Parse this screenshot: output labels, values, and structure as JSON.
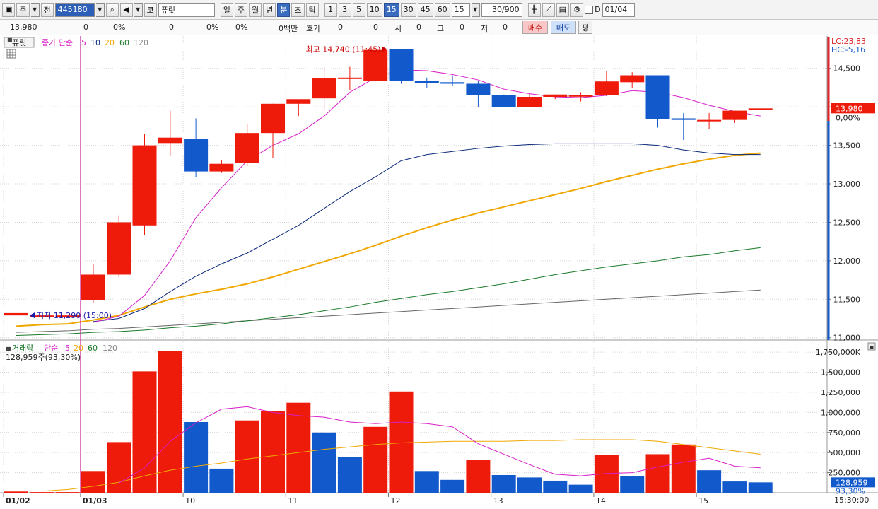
{
  "toolbar": {
    "market": "주",
    "whole": "전",
    "code": "445180",
    "market_type": "코",
    "stock_name": "퓨릿",
    "periods": [
      "일",
      "주",
      "월",
      "년"
    ],
    "units": [
      "분",
      "초",
      "틱"
    ],
    "active_unit": "분",
    "intervals": [
      "1",
      "3",
      "5",
      "10",
      "15",
      "30",
      "45",
      "60"
    ],
    "active_interval": "15",
    "interval_value": "15",
    "count": "30",
    "count_max": "/900",
    "d_label": "D",
    "date": "01/04"
  },
  "quote": {
    "price": "13,980",
    "change": "0",
    "change_pct": "0%",
    "volume": "0",
    "vol_pct": "0%",
    "vol_pct2": "0%",
    "amount": "0백만",
    "hoga_label": "호가",
    "hoga_val1": "0",
    "hoga_val2": "0",
    "open_label": "시",
    "open_val": "0",
    "high_label": "고",
    "high_val": "0",
    "low_label": "저",
    "low_val": "0",
    "buy_label": "매수",
    "sell_label": "매도",
    "flat_label": "평"
  },
  "price_panel": {
    "title": "퓨릿",
    "ma_label": "종가 단순",
    "ma_periods": [
      "5",
      "10",
      "20",
      "60",
      "120"
    ],
    "lc": "LC:23,83",
    "hc": "HC:-5,16",
    "current_price": "13,980",
    "current_pct": "0,00%",
    "high_annotation": "최고 14,740 (11:45)",
    "low_annotation": "최저 11,290 (15:00)"
  },
  "volume_panel": {
    "title": "거래량",
    "ma_label": "단순",
    "ma_periods": [
      "5",
      "20",
      "60",
      "120"
    ],
    "summary": "128,959주(93,30%)",
    "current_volume": "128,959",
    "current_pct": "93,30%"
  },
  "colors": {
    "up": "#ee1b0b",
    "down": "#1259cc",
    "ma5": "#d91ec8",
    "ma10": "#0b2a7a",
    "ma20": "#f0a800",
    "ma60": "#1a7a2a",
    "ma120": "#555555",
    "grid": "#d6d6d6"
  },
  "chart_data": {
    "type": "candlestick",
    "price_axis": {
      "ticks": [
        11000,
        11500,
        12000,
        12500,
        13000,
        13500,
        14000,
        14500
      ],
      "tick_labels": [
        "11,000",
        "11,500",
        "12,000",
        "12,500",
        "13,000",
        "13,500",
        "",
        "14,500"
      ],
      "range": [
        10970,
        14920
      ]
    },
    "volume_axis": {
      "ticks": [
        250000,
        500000,
        750000,
        1000000,
        1250000,
        1500000,
        1750000
      ],
      "tick_labels": [
        "250,000",
        "500,000",
        "750,000",
        "1,000,000",
        "1,250,000",
        "1,500,000",
        "1,750,000K"
      ],
      "range": [
        0,
        1830000
      ]
    },
    "x_labels": [
      {
        "index": 0,
        "label": "01/02"
      },
      {
        "index": 3,
        "label": "01/03"
      },
      {
        "index": 7,
        "label": "10"
      },
      {
        "index": 11,
        "label": "11"
      },
      {
        "index": 15,
        "label": "12"
      },
      {
        "index": 19,
        "label": "13"
      },
      {
        "index": 23,
        "label": "14"
      },
      {
        "index": 27,
        "label": "15"
      }
    ],
    "time_label": "15:30:00",
    "candles": [
      {
        "o": 11290,
        "h": 11290,
        "l": 11290,
        "c": 11320,
        "v": 15000
      },
      {
        "o": 11290,
        "h": 11290,
        "l": 11290,
        "c": 11290,
        "v": 8000
      },
      {
        "o": 11290,
        "h": 11290,
        "l": 11290,
        "c": 11290,
        "v": 8000
      },
      {
        "o": 11490,
        "h": 11960,
        "l": 11450,
        "c": 11820,
        "v": 270000
      },
      {
        "o": 11820,
        "h": 12590,
        "l": 11790,
        "c": 12500,
        "v": 630000
      },
      {
        "o": 12460,
        "h": 13650,
        "l": 12330,
        "c": 13500,
        "v": 1510000
      },
      {
        "o": 13530,
        "h": 13950,
        "l": 13360,
        "c": 13600,
        "v": 1760000
      },
      {
        "o": 13580,
        "h": 13850,
        "l": 13090,
        "c": 13160,
        "v": 880000
      },
      {
        "o": 13160,
        "h": 13310,
        "l": 13140,
        "c": 13260,
        "v": 300000
      },
      {
        "o": 13270,
        "h": 13780,
        "l": 13230,
        "c": 13660,
        "v": 900000
      },
      {
        "o": 13660,
        "h": 14040,
        "l": 13340,
        "c": 14040,
        "v": 1020000
      },
      {
        "o": 14040,
        "h": 14060,
        "l": 13880,
        "c": 14100,
        "v": 1120000
      },
      {
        "o": 14110,
        "h": 14510,
        "l": 13960,
        "c": 14370,
        "v": 750000
      },
      {
        "o": 14370,
        "h": 14520,
        "l": 14220,
        "c": 14380,
        "v": 440000
      },
      {
        "o": 14340,
        "h": 14740,
        "l": 14340,
        "c": 14740,
        "v": 820000
      },
      {
        "o": 14750,
        "h": 14750,
        "l": 14300,
        "c": 14340,
        "v": 1260000
      },
      {
        "o": 14340,
        "h": 14380,
        "l": 14250,
        "c": 14310,
        "v": 270000
      },
      {
        "o": 14320,
        "h": 14410,
        "l": 14270,
        "c": 14300,
        "v": 160000
      },
      {
        "o": 14300,
        "h": 14340,
        "l": 14000,
        "c": 14150,
        "v": 410000
      },
      {
        "o": 14150,
        "h": 14160,
        "l": 14040,
        "c": 14000,
        "v": 220000
      },
      {
        "o": 14000,
        "h": 14170,
        "l": 14000,
        "c": 14130,
        "v": 190000
      },
      {
        "o": 14130,
        "h": 14160,
        "l": 14100,
        "c": 14160,
        "v": 150000
      },
      {
        "o": 14140,
        "h": 14190,
        "l": 14070,
        "c": 14150,
        "v": 100000
      },
      {
        "o": 14150,
        "h": 14470,
        "l": 14140,
        "c": 14330,
        "v": 470000
      },
      {
        "o": 14320,
        "h": 14450,
        "l": 14240,
        "c": 14410,
        "v": 210000
      },
      {
        "o": 14410,
        "h": 14410,
        "l": 13730,
        "c": 13840,
        "v": 480000
      },
      {
        "o": 13850,
        "h": 13920,
        "l": 13570,
        "c": 13830,
        "v": 600000
      },
      {
        "o": 13820,
        "h": 13920,
        "l": 13710,
        "c": 13830,
        "v": 280000
      },
      {
        "o": 13830,
        "h": 13950,
        "l": 13790,
        "c": 13950,
        "v": 140000
      },
      {
        "o": 13980,
        "h": 13980,
        "l": 13980,
        "c": 13980,
        "v": 128959
      }
    ],
    "volume_colors": [
      "up",
      "up",
      "up",
      "up",
      "up",
      "up",
      "up",
      "down",
      "down",
      "up",
      "up",
      "up",
      "down",
      "down",
      "up",
      "up",
      "down",
      "down",
      "up",
      "down",
      "down",
      "down",
      "down",
      "up",
      "down",
      "up",
      "up",
      "down",
      "down",
      "down"
    ],
    "ma5": [
      null,
      null,
      null,
      11200,
      11280,
      11550,
      12000,
      12560,
      12950,
      13300,
      13500,
      13650,
      13880,
      14190,
      14380,
      14480,
      14470,
      14420,
      14350,
      14230,
      14170,
      14130,
      14120,
      14150,
      14210,
      14190,
      14120,
      14020,
      13940,
      13880
    ],
    "ma10": [
      null,
      null,
      null,
      11210,
      11250,
      11380,
      11600,
      11800,
      11960,
      12100,
      12280,
      12460,
      12680,
      12900,
      13090,
      13300,
      13380,
      13420,
      13460,
      13490,
      13510,
      13520,
      13520,
      13520,
      13520,
      13500,
      13440,
      13400,
      13380,
      13380
    ],
    "ma20": [
      11150,
      11170,
      11180,
      11230,
      11290,
      11400,
      11500,
      11570,
      11630,
      11700,
      11790,
      11890,
      11990,
      12090,
      12200,
      12320,
      12430,
      12530,
      12620,
      12700,
      12780,
      12860,
      12940,
      13030,
      13110,
      13190,
      13260,
      13320,
      13370,
      13400
    ],
    "ma60": [
      11030,
      11040,
      11050,
      11070,
      11080,
      11100,
      11130,
      11150,
      11180,
      11220,
      11260,
      11300,
      11350,
      11400,
      11460,
      11510,
      11560,
      11600,
      11650,
      11700,
      11760,
      11820,
      11870,
      11920,
      11960,
      12000,
      12050,
      12080,
      12130,
      12170
    ],
    "ma120": [
      11070,
      11080,
      11090,
      11110,
      11120,
      11140,
      11160,
      11180,
      11200,
      11220,
      11240,
      11260,
      11280,
      11300,
      11320,
      11340,
      11360,
      11380,
      11400,
      11420,
      11440,
      11460,
      11480,
      11500,
      11520,
      11540,
      11560,
      11580,
      11600,
      11620
    ],
    "vol_ma5": [
      null,
      null,
      null,
      null,
      120000,
      310000,
      640000,
      870000,
      1040000,
      1070000,
      1000000,
      960000,
      940000,
      880000,
      860000,
      880000,
      860000,
      820000,
      610000,
      480000,
      350000,
      230000,
      210000,
      240000,
      250000,
      320000,
      380000,
      430000,
      330000,
      310000
    ],
    "vol_ma20": [
      null,
      20000,
      40000,
      80000,
      130000,
      210000,
      280000,
      330000,
      370000,
      420000,
      460000,
      500000,
      540000,
      570000,
      600000,
      620000,
      630000,
      640000,
      640000,
      640000,
      650000,
      650000,
      660000,
      660000,
      660000,
      640000,
      600000,
      560000,
      520000,
      480000
    ]
  }
}
